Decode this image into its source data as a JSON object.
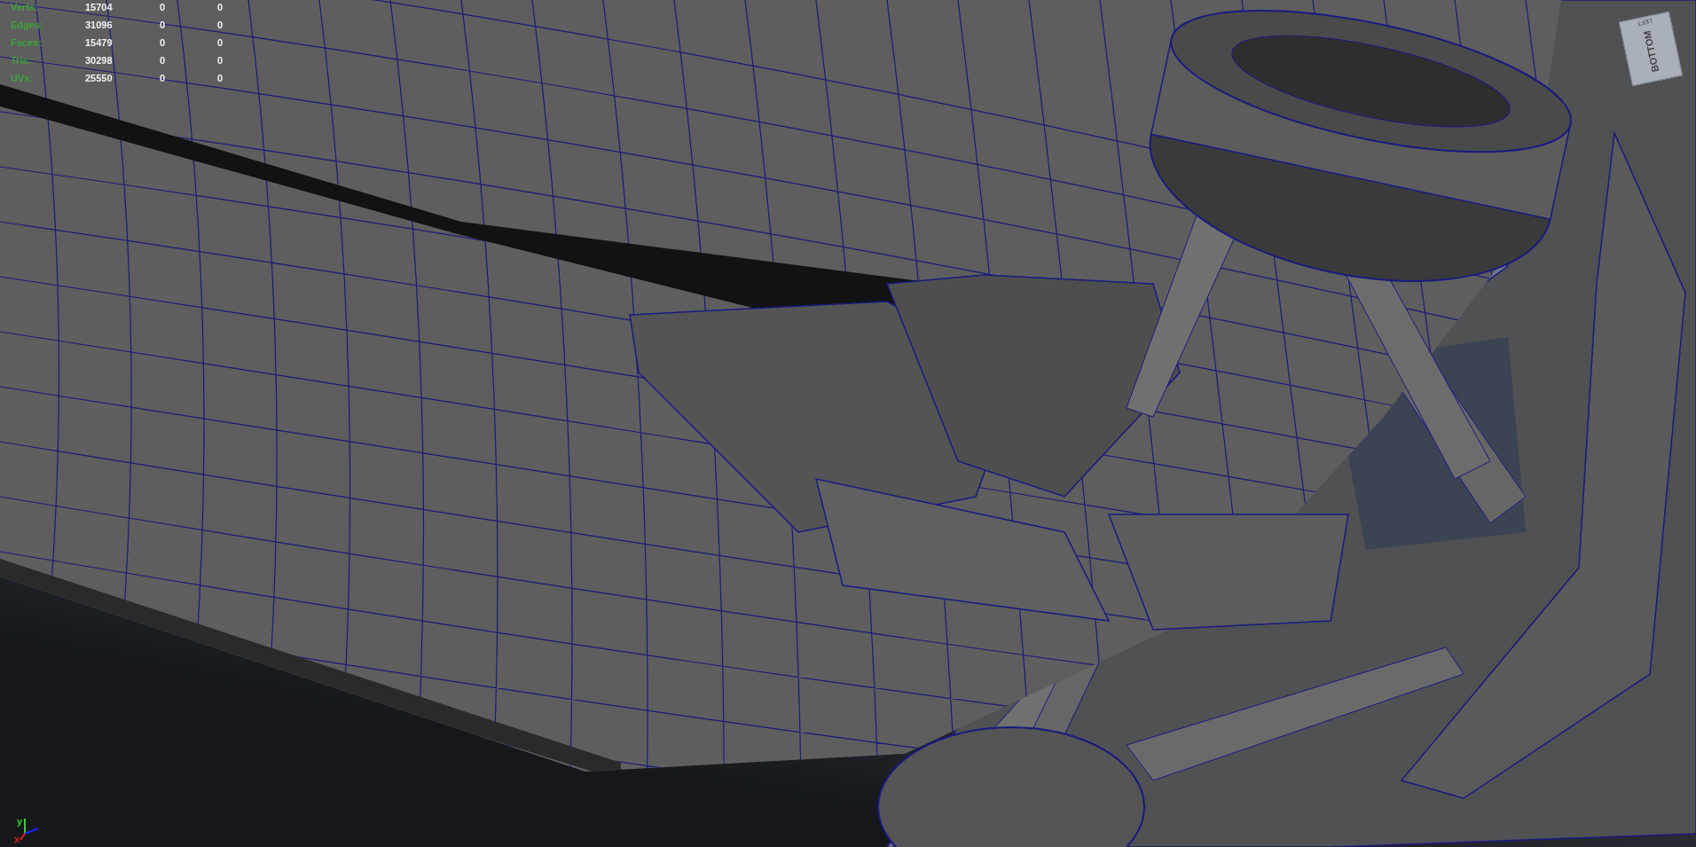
{
  "hud": [
    {
      "label": "Verts:",
      "values": [
        "15704",
        "0",
        "0"
      ]
    },
    {
      "label": "Edges:",
      "values": [
        "31096",
        "0",
        "0"
      ]
    },
    {
      "label": "Faces:",
      "values": [
        "15479",
        "0",
        "0"
      ]
    },
    {
      "label": "Tris:",
      "values": [
        "30298",
        "0",
        "0"
      ]
    },
    {
      "label": "UVs:",
      "values": [
        "25550",
        "0",
        "0"
      ]
    }
  ],
  "view_cube": {
    "top_face": "LEFT",
    "front_face": "BOTTOM"
  },
  "axis": {
    "y": "y",
    "x": "x"
  }
}
